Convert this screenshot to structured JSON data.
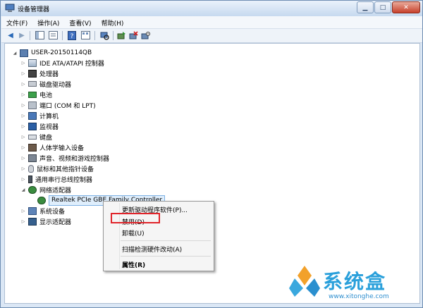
{
  "window": {
    "title": "设备管理器"
  },
  "menubar": [
    {
      "label": "文件(F)"
    },
    {
      "label": "操作(A)"
    },
    {
      "label": "查看(V)"
    },
    {
      "label": "帮助(H)"
    }
  ],
  "tree": {
    "root": "USER-20150114QB",
    "categories": [
      {
        "label": "IDE ATA/ATAPI 控制器",
        "icon": "ide-controller-icon"
      },
      {
        "label": "处理器",
        "icon": "processor-icon"
      },
      {
        "label": "磁盘驱动器",
        "icon": "disk-drive-icon"
      },
      {
        "label": "电池",
        "icon": "battery-icon"
      },
      {
        "label": "端口 (COM 和 LPT)",
        "icon": "port-icon"
      },
      {
        "label": "计算机",
        "icon": "computer-icon"
      },
      {
        "label": "监视器",
        "icon": "monitor-icon"
      },
      {
        "label": "键盘",
        "icon": "keyboard-icon"
      },
      {
        "label": "人体学输入设备",
        "icon": "hid-icon"
      },
      {
        "label": "声音、视频和游戏控制器",
        "icon": "sound-icon"
      },
      {
        "label": "鼠标和其他指针设备",
        "icon": "mouse-icon"
      },
      {
        "label": "通用串行总线控制器",
        "icon": "usb-icon"
      },
      {
        "label": "网络适配器",
        "icon": "network-adapter-icon"
      }
    ],
    "selected_device": "Realtek PCIe GBE Family Controller",
    "after_categories": [
      {
        "label": "系统设备",
        "icon": "system-devices-icon"
      },
      {
        "label": "显示适配器",
        "icon": "display-adapter-icon"
      }
    ]
  },
  "context_menu": {
    "update_driver": "更新驱动程序软件(P)...",
    "disable": "禁用(D)",
    "uninstall": "卸载(U)",
    "scan": "扫描检测硬件改动(A)",
    "properties": "属性(R)"
  },
  "colors": {
    "highlight": "#e0242a",
    "selection": "#dfeefc"
  },
  "watermark": {
    "brand": "系统盒",
    "url": "www.xitonghe.com"
  }
}
